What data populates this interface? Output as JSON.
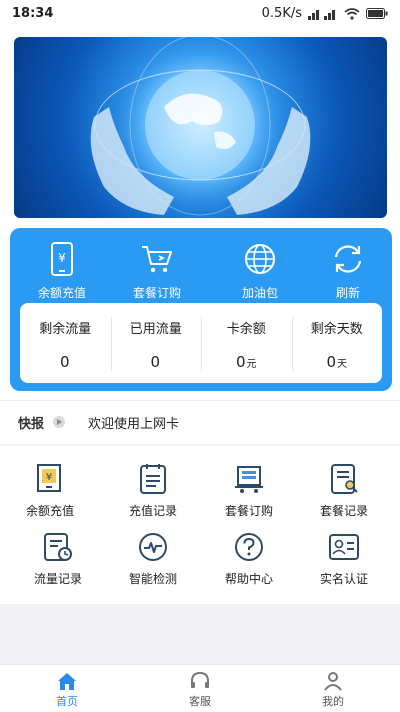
{
  "status_bar": {
    "time": "18:34",
    "net_speed": "0.5K/s"
  },
  "actions": [
    {
      "label": "余额充值",
      "icon": "phone-yuan-icon"
    },
    {
      "label": "套餐订购",
      "icon": "cart-icon"
    },
    {
      "label": "加油包",
      "icon": "globe-icon"
    },
    {
      "label": "刷新",
      "icon": "refresh-icon"
    }
  ],
  "stats": [
    {
      "label": "剩余流量",
      "value": "0",
      "unit": ""
    },
    {
      "label": "已用流量",
      "value": "0",
      "unit": ""
    },
    {
      "label": "卡余额",
      "value": "0",
      "unit": "元"
    },
    {
      "label": "剩余天数",
      "value": "0",
      "unit": "天"
    }
  ],
  "news": {
    "tag": "快报",
    "text": "欢迎使用上网卡"
  },
  "grid": [
    {
      "label": "余额充值",
      "icon": "recharge-icon"
    },
    {
      "label": "充值记录",
      "icon": "recharge-record-icon"
    },
    {
      "label": "套餐订购",
      "icon": "package-order-icon"
    },
    {
      "label": "套餐记录",
      "icon": "package-record-icon"
    },
    {
      "label": "流量记录",
      "icon": "traffic-record-icon"
    },
    {
      "label": "智能检测",
      "icon": "smart-detect-icon"
    },
    {
      "label": "帮助中心",
      "icon": "help-icon"
    },
    {
      "label": "实名认证",
      "icon": "id-card-icon"
    }
  ],
  "nav": [
    {
      "label": "首页",
      "icon": "home-icon",
      "active": true
    },
    {
      "label": "客服",
      "icon": "headset-icon",
      "active": false
    },
    {
      "label": "我的",
      "icon": "user-icon",
      "active": false
    }
  ],
  "colors": {
    "accent": "#2b9af3",
    "nav_active": "#2b8be8",
    "icon_line": "#2d4a66"
  }
}
